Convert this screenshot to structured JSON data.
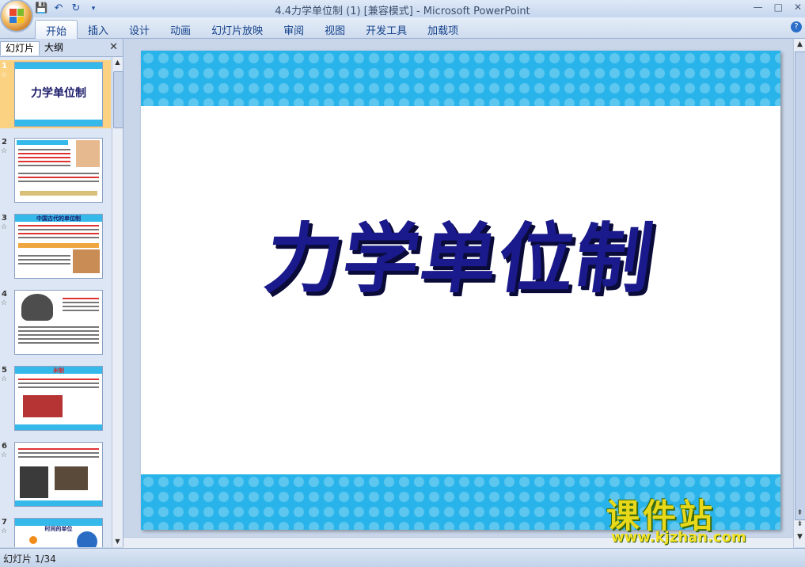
{
  "window": {
    "title": "4.4力学单位制 (1) [兼容模式] - Microsoft PowerPoint",
    "controls": [
      "—",
      "□",
      "✕"
    ]
  },
  "ribbon": {
    "tabs": [
      "开始",
      "插入",
      "设计",
      "动画",
      "幻灯片放映",
      "审阅",
      "视图",
      "开发工具",
      "加载项"
    ],
    "active_tab": "开始",
    "help": "?"
  },
  "panel": {
    "tab_slides": "幻灯片",
    "tab_outline": "大纲",
    "close": "✕",
    "thumbs": [
      {
        "num": "1",
        "title": "力学单位制",
        "selected": true
      },
      {
        "num": "2",
        "title": "",
        "selected": false
      },
      {
        "num": "3",
        "title": "中国古代的单位制",
        "selected": false
      },
      {
        "num": "4",
        "title": "",
        "selected": false
      },
      {
        "num": "5",
        "title": "米制",
        "selected": false
      },
      {
        "num": "6",
        "title": "",
        "selected": false
      },
      {
        "num": "7",
        "title": "时间的单位",
        "selected": false
      }
    ],
    "star": "☆"
  },
  "slide": {
    "title": "力学单位制"
  },
  "status": {
    "slide_indicator": "幻灯片 1/34"
  },
  "watermark": {
    "title": "课件站",
    "url": "www.kjzhan.com"
  },
  "colors": {
    "accent_blue": "#28b4ea",
    "title_navy": "#1a1a8c",
    "selection": "#fbd281"
  }
}
